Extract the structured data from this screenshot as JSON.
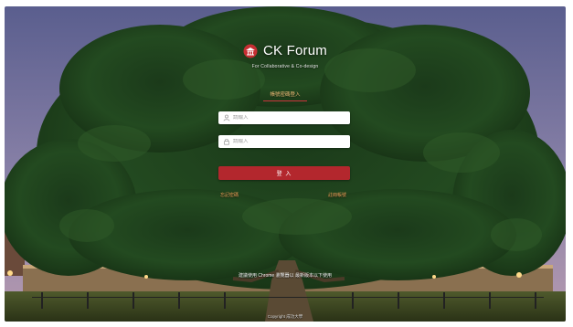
{
  "brand": {
    "title": "CK Forum",
    "tagline": "For Collaborative & Co-design"
  },
  "tabs": {
    "active_label": "帳號密碼登入"
  },
  "form": {
    "username_placeholder": "請輸入",
    "password_placeholder": "請輸入",
    "submit_label": "登 入"
  },
  "links": {
    "forgot": "忘記密碼",
    "register": "註冊帳號"
  },
  "footer": {
    "notice": "建議使用 Chrome 瀏覽器以 最新版本以下使用",
    "copyright": "Copyright    成功大學"
  },
  "icons": {
    "logo": "temple-logo-icon",
    "user": "user-icon",
    "lock": "lock-icon"
  },
  "colors": {
    "accent": "#b3272d",
    "link": "#f0a15a",
    "tab_text": "#f1c07a"
  }
}
